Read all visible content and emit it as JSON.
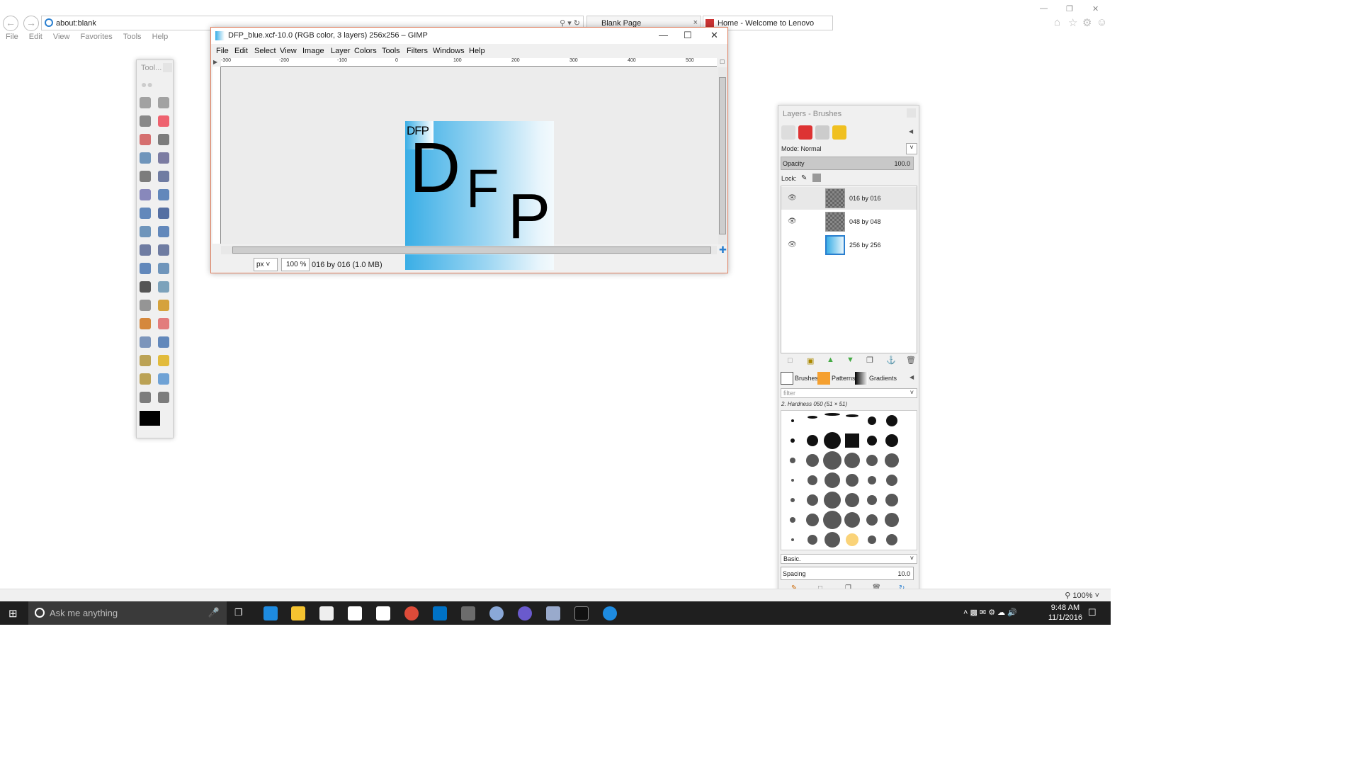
{
  "browser": {
    "address": "about:blank",
    "tabs": [
      "Blank Page",
      "Home - Welcome to Lenovo"
    ],
    "menu": [
      "File",
      "Edit",
      "View",
      "Favorites",
      "Tools",
      "Help"
    ],
    "zoom": "100%"
  },
  "toolbox": {
    "title": "Tool..."
  },
  "image_window": {
    "title": "DFP_blue.xcf-10.0 (RGB color, 3 layers) 256x256 – GIMP",
    "menu": [
      "File",
      "Edit",
      "Select",
      "View",
      "Image",
      "Layer",
      "Colors",
      "Tools",
      "Filters",
      "Windows",
      "Help"
    ],
    "ruler_labels": [
      "-300",
      "-200",
      "-100",
      "0",
      "100",
      "200",
      "300",
      "400",
      "500"
    ],
    "unit": "px",
    "zoom": "100 %",
    "status": "016 by 016 (1.0 MB)",
    "image_letters": {
      "d": "D",
      "f": "F",
      "p": "P",
      "small": "DFP"
    }
  },
  "dock": {
    "title": "Layers - Brushes",
    "mode_label": "Mode: Normal",
    "opacity_label": "Opacity",
    "opacity_value": "100.0",
    "lock_label": "Lock:",
    "layers": [
      {
        "name": "016 by 016",
        "visible": true
      },
      {
        "name": "048 by 048",
        "visible": true
      },
      {
        "name": "256 by 256",
        "visible": true
      }
    ],
    "brush_tabs": [
      "Brushes",
      "Patterns",
      "Gradients"
    ],
    "filter_placeholder": "filter",
    "brush_name": "2. Hardness 050 (51 × 51)",
    "brush_set": "Basic.",
    "spacing_label": "Spacing",
    "spacing_value": "10.0"
  },
  "taskbar": {
    "search_placeholder": "Ask me anything",
    "time": "9:48 AM",
    "date": "11/1/2016"
  }
}
